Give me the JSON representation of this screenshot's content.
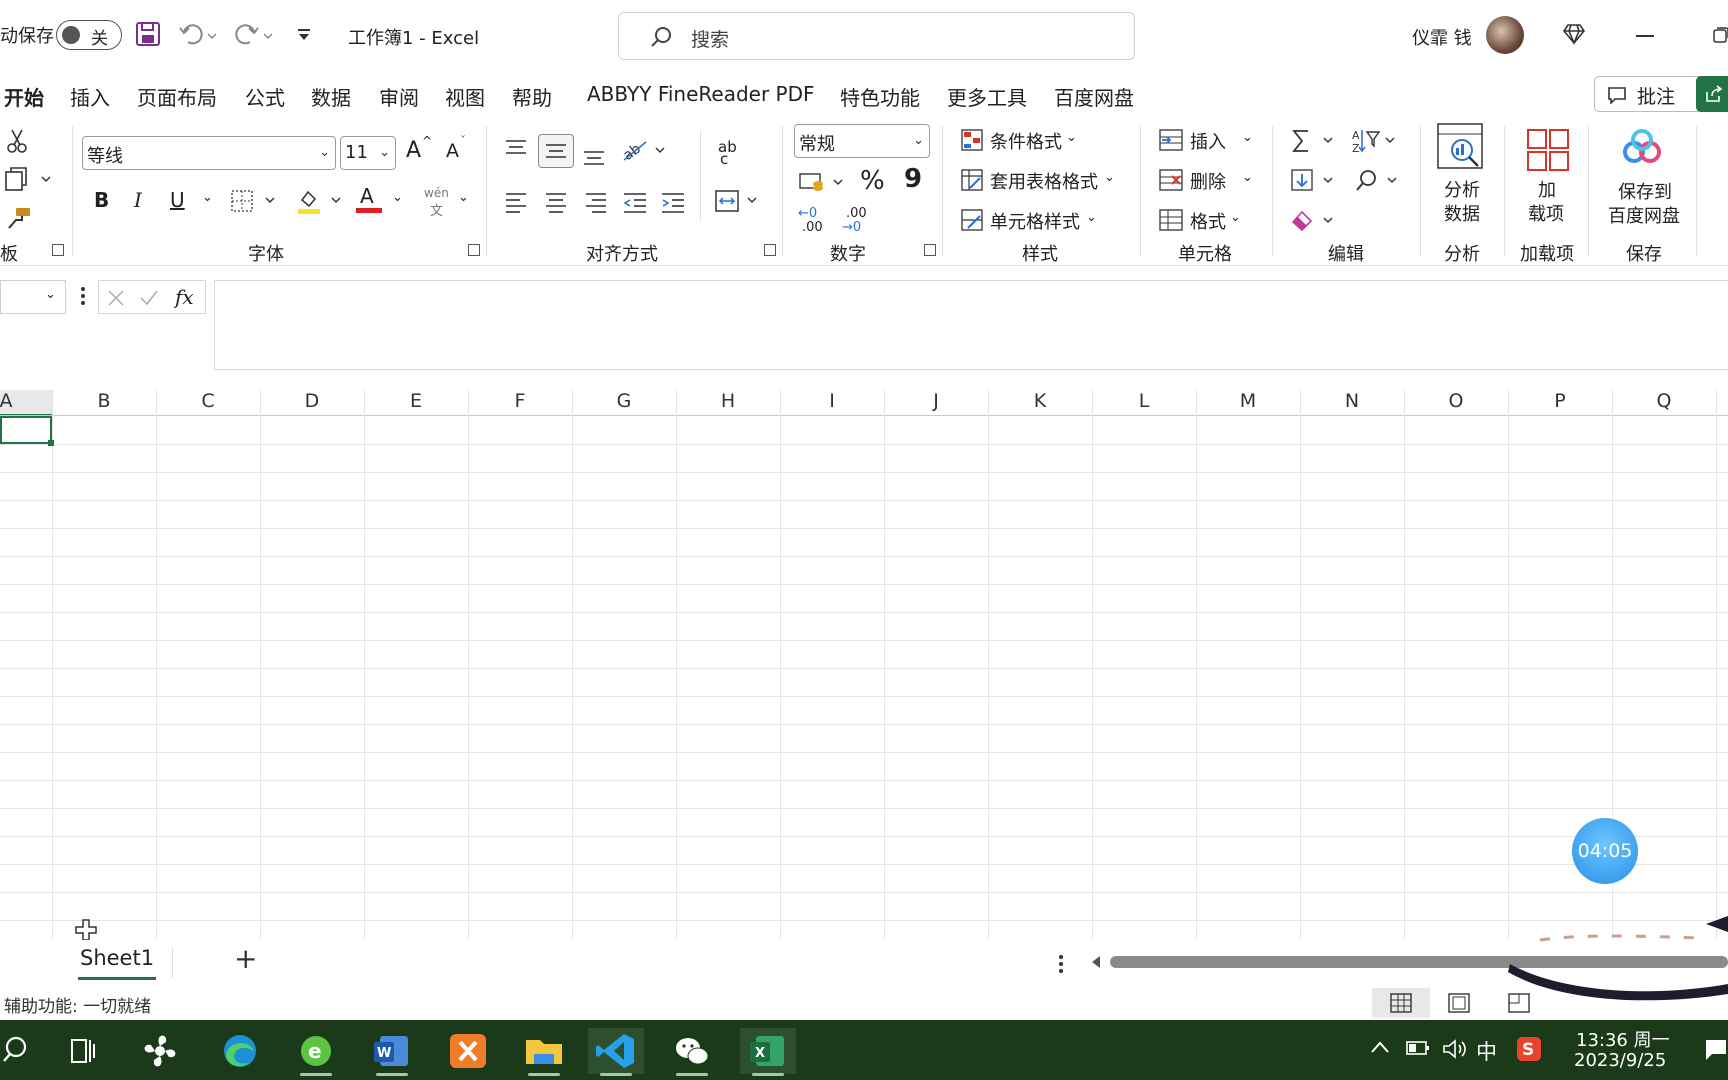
{
  "titlebar": {
    "autosave_label": "动保存",
    "autosave_state": "关",
    "doc_title": "工作簿1  -  Excel",
    "search_placeholder": "搜索",
    "username": "仪霏 钱"
  },
  "tabs": [
    {
      "label": "开始",
      "active": true
    },
    {
      "label": "插入"
    },
    {
      "label": "页面布局"
    },
    {
      "label": "公式"
    },
    {
      "label": "数据"
    },
    {
      "label": "审阅"
    },
    {
      "label": "视图"
    },
    {
      "label": "帮助"
    },
    {
      "label": "ABBYY FineReader PDF"
    },
    {
      "label": "特色功能"
    },
    {
      "label": "更多工具"
    },
    {
      "label": "百度网盘"
    }
  ],
  "comment_button": "批注",
  "ribbon": {
    "clipboard_label": "板",
    "font": {
      "name": "等线",
      "size": "11",
      "label": "字体",
      "bold": "B",
      "italic": "I",
      "underline": "U",
      "phonetic_top": "wén",
      "phonetic_bottom": "文",
      "grow": "A",
      "shrink": "A",
      "font_color": "A"
    },
    "alignment": {
      "label": "对齐方式",
      "wrap_top": "ab",
      "wrap_bottom": "c"
    },
    "number": {
      "format": "常规",
      "label": "数字",
      "percent": "%",
      "comma": "9",
      "inc_top": "←0",
      "inc_bottom": ".00",
      "dec_top": ".00",
      "dec_bottom": "→0"
    },
    "styles": {
      "label": "样式",
      "conditional": "条件格式",
      "table": "套用表格格式",
      "cell_styles": "单元格样式"
    },
    "cells": {
      "label": "单元格",
      "insert": "插入",
      "delete": "删除",
      "format": "格式"
    },
    "editing": {
      "label": "编辑"
    },
    "analysis": {
      "label": "分析",
      "button_line1": "分析",
      "button_line2": "数据"
    },
    "addins": {
      "label": "加载项",
      "button_line1": "加",
      "button_line2": "载项"
    },
    "save": {
      "label": "保存",
      "button_line1": "保存到",
      "button_line2": "百度网盘"
    }
  },
  "formula": {
    "fx": "fx"
  },
  "columns": [
    "A",
    "B",
    "C",
    "D",
    "E",
    "F",
    "G",
    "H",
    "I",
    "J",
    "K",
    "L",
    "M",
    "N",
    "O",
    "P",
    "Q"
  ],
  "timer": "04:05",
  "sheets": [
    {
      "name": "Sheet1",
      "active": true
    }
  ],
  "add_sheet": "+",
  "status": "辅助功能: 一切就绪",
  "taskbar": {
    "apps": [
      {
        "name": "task-view"
      },
      {
        "name": "fan-app"
      },
      {
        "name": "edge"
      },
      {
        "name": "browser-e",
        "running": true
      },
      {
        "name": "word",
        "running": true
      },
      {
        "name": "xampp"
      },
      {
        "name": "file-explorer",
        "running": true
      },
      {
        "name": "vscode",
        "running": true
      },
      {
        "name": "wechat",
        "running": true
      },
      {
        "name": "excel",
        "running": true
      }
    ],
    "ime": "中",
    "time": "13:36 周一",
    "date": "2023/9/25"
  },
  "colors": {
    "accent": "#217346",
    "taskbar": "#1a3a1a",
    "timer": "#2a8fe6"
  }
}
